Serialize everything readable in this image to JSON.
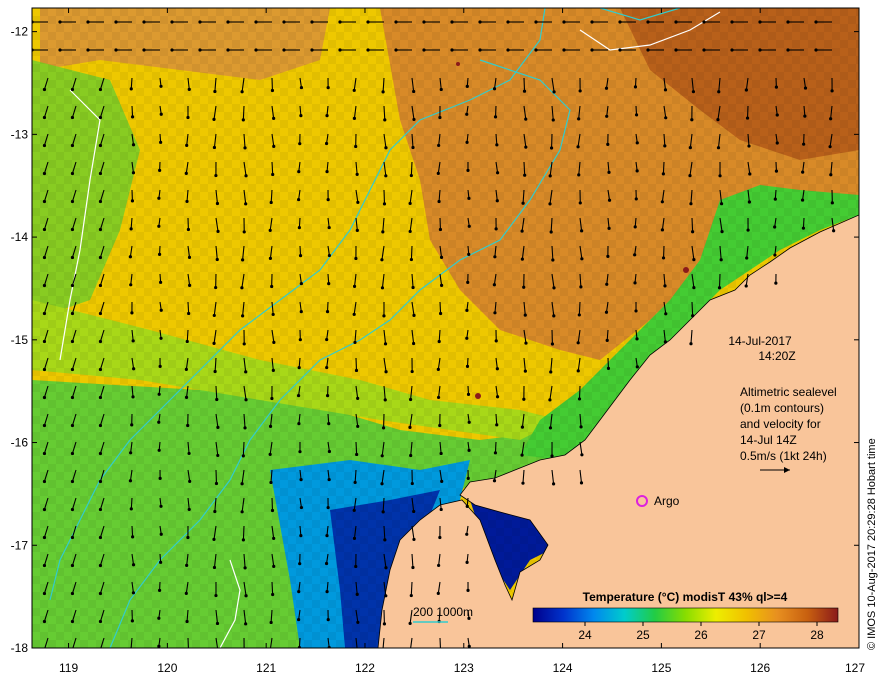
{
  "map": {
    "date_line1": "14-Jul-2017",
    "date_line2": "14:20Z",
    "notes": [
      "Altimetric sealevel",
      "(0.1m contours)",
      "and velocity for",
      "14-Jul 14Z",
      "0.5m/s (1kt 24h)"
    ],
    "argo_label": "Argo",
    "bathy_label": "200  1000m",
    "credit": "© IMOS 10-Aug-2017 20:29:28 Hobart time",
    "colorbar": {
      "title": "Temperature (°C) modisT 43% ql>=4",
      "ticks": [
        "24",
        "25",
        "26",
        "27",
        "28"
      ],
      "stops": [
        "#00008b",
        "#0033cc",
        "#0088ee",
        "#00cccc",
        "#22cc44",
        "#88dd00",
        "#eeee00",
        "#f0c000",
        "#e89020",
        "#c86010",
        "#8b1a1a"
      ]
    },
    "x_ticks": [
      "119",
      "120",
      "121",
      "122",
      "123",
      "124",
      "125",
      "126",
      "127"
    ],
    "y_ticks": [
      "-12",
      "-13",
      "-14",
      "-15",
      "-16",
      "-17",
      "-18"
    ],
    "land_color": "#f9c59a",
    "contour_color": "#33cccc",
    "argo_color": "#dd22dd"
  }
}
